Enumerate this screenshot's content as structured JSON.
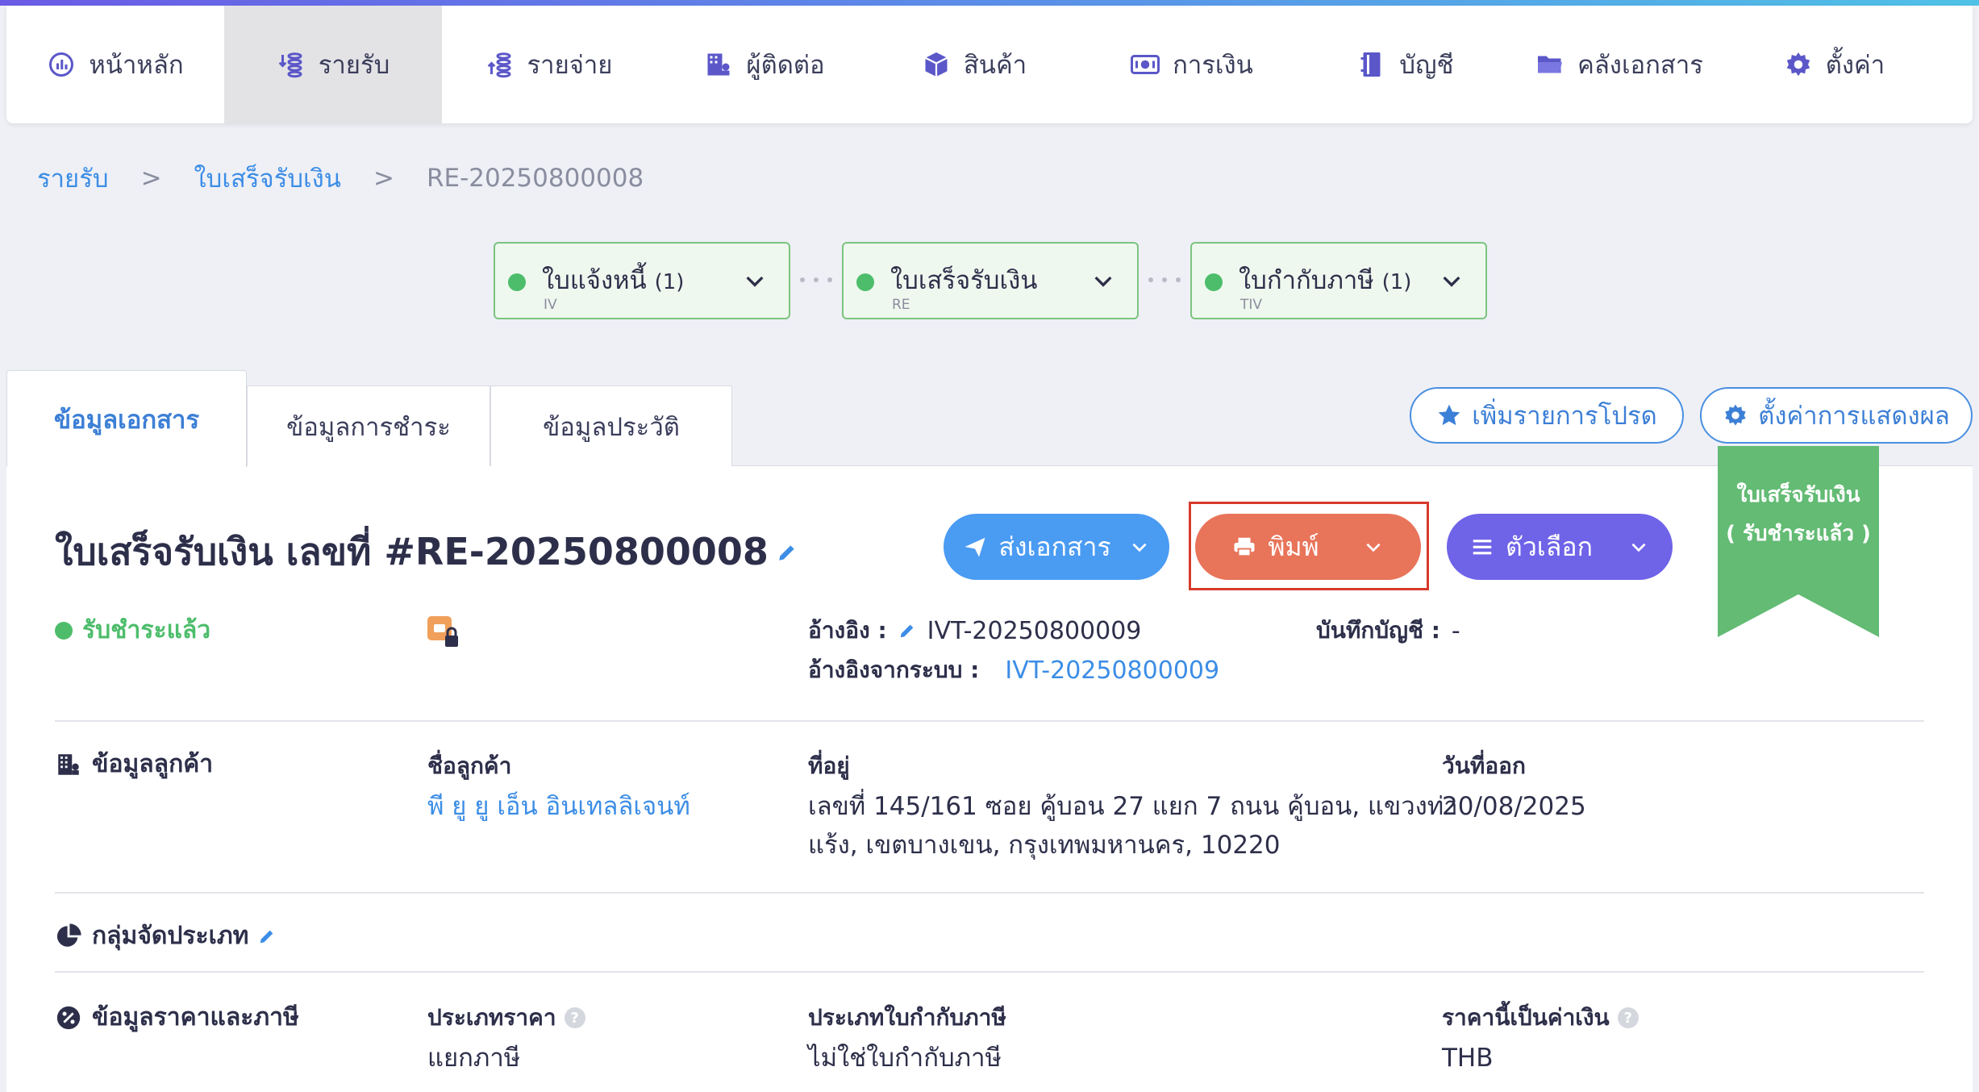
{
  "nav": {
    "items": [
      {
        "label": "หน้าหลัก",
        "icon": "dashboard-icon"
      },
      {
        "label": "รายรับ",
        "icon": "income-icon"
      },
      {
        "label": "รายจ่าย",
        "icon": "expense-icon"
      },
      {
        "label": "ผู้ติดต่อ",
        "icon": "contacts-icon"
      },
      {
        "label": "สินค้า",
        "icon": "box-icon"
      },
      {
        "label": "การเงิน",
        "icon": "money-icon"
      },
      {
        "label": "บัญชี",
        "icon": "book-icon"
      },
      {
        "label": "คลังเอกสาร",
        "icon": "folder-icon"
      },
      {
        "label": "ตั้งค่า",
        "icon": "gear-icon"
      }
    ],
    "active": "รายรับ"
  },
  "breadcrumb": {
    "level1": "รายรับ",
    "level2": "ใบเสร็จรับเงิน",
    "current": "RE-20250800008",
    "separator": ">"
  },
  "workflow": [
    {
      "title": "ใบแจ้งหนี้",
      "count": "(1)",
      "code": "IV"
    },
    {
      "title": "ใบเสร็จรับเงิน",
      "count": "",
      "code": "RE"
    },
    {
      "title": "ใบกำกับภาษี",
      "count": "(1)",
      "code": "TIV"
    }
  ],
  "tabs": {
    "doc_info": "ข้อมูลเอกสาร",
    "payment_info": "ข้อมูลการชำระ",
    "history_info": "ข้อมูลประวัติ"
  },
  "actions": {
    "favorite": "เพิ่มรายการโปรด",
    "display_settings": "ตั้งค่าการแสดงผล"
  },
  "document": {
    "title": "ใบเสร็จรับเงิน เลขที่ #RE-20250800008",
    "send_label": "ส่งเอกสาร",
    "print_label": "พิมพ์",
    "options_label": "ตัวเลือก",
    "ribbon_line1": "ใบเสร็จรับเงิน",
    "ribbon_line2": "( รับชำระแล้ว )",
    "status": "รับชำระแล้ว",
    "ref_label": "อ้างอิง :",
    "ref_value": "IVT-20250800009",
    "sys_ref_label": "อ้างอิงจากระบบ :",
    "sys_ref_value": "IVT-20250800009",
    "journal_label": "บันทึกบัญชี :",
    "journal_value": "-"
  },
  "customer": {
    "section": "ข้อมูลลูกค้า",
    "name_label": "ชื่อลูกค้า",
    "name_value": "พี ยู ยู เอ็น อินเทลลิเจนท์",
    "address_label": "ที่อยู่",
    "address_line1": "เลขที่ 145/161 ซอย คู้บอน 27 แยก 7 ถนน คู้บอน, แขวงท่า",
    "address_line2": "แร้ง, เขตบางเขน, กรุงเทพมหานคร, 10220",
    "date_label": "วันที่ออก",
    "date_value": "20/08/2025"
  },
  "category": {
    "section": "กลุ่มจัดประเภท"
  },
  "pricing": {
    "section": "ข้อมูลราคาและภาษี",
    "price_type_label": "ประเภทราคา",
    "price_type_value": "แยกภาษี",
    "tax_invoice_label": "ประเภทใบกำกับภาษี",
    "tax_invoice_value": "ไม่ใช่ใบกำกับภาษี",
    "currency_label": "ราคานี้เป็นค่าเงิน",
    "currency_value": "THB"
  },
  "colors": {
    "accent_blue": "#3c8de6",
    "send_button": "#4a9bf2",
    "print_button": "#e8745a",
    "options_button": "#6f63e8",
    "status_green": "#4dbd6b",
    "highlight_red": "#d63a2b"
  }
}
